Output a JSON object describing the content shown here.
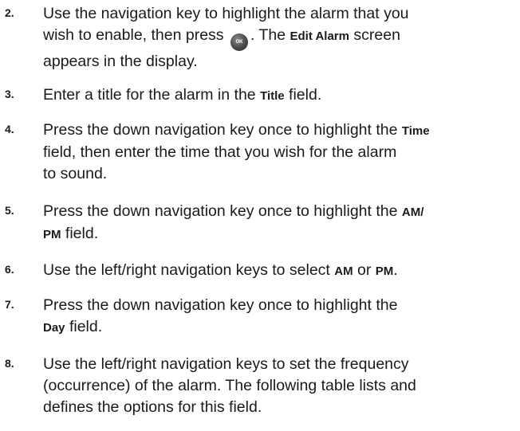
{
  "steps": [
    {
      "num": "2.",
      "lines": {
        "l1": "Use the navigation key to highlight the alarm that you",
        "l2a": "wish to enable, then press ",
        "ok_label": "OK",
        "l2b": ". The ",
        "l2_kw": "Edit Alarm",
        "l2c": " screen",
        "l3": "appears in the display."
      }
    },
    {
      "num": "3.",
      "lines": {
        "l1a": "Enter a title for the alarm in the ",
        "l1_kw": "Title",
        "l1b": " field."
      }
    },
    {
      "num": "4.",
      "lines": {
        "l1a": "Press the down navigation key once to highlight the ",
        "l1_kw": "Time",
        "l2": "field, then enter the time that you wish for the alarm",
        "l3": "to sound."
      }
    },
    {
      "num": "5.",
      "lines": {
        "l1a": "Press the down navigation key once to highlight the ",
        "l1_kw": "AM/",
        "l2_kw": "PM",
        "l2b": " field."
      }
    },
    {
      "num": "6.",
      "lines": {
        "l1a": "Use the left/right navigation keys to select ",
        "kw1": "AM",
        "l1b": " or ",
        "kw2": "PM",
        "l1c": "."
      }
    },
    {
      "num": "7.",
      "lines": {
        "l1": "Press the down navigation key once to highlight the",
        "l2_kw": "Day",
        "l2b": " field."
      }
    },
    {
      "num": "8.",
      "lines": {
        "l1": "Use the left/right navigation keys to set the frequency",
        "l2": "(occurrence) of the alarm. The following table lists and",
        "l3": "defines the options for this field."
      }
    }
  ]
}
